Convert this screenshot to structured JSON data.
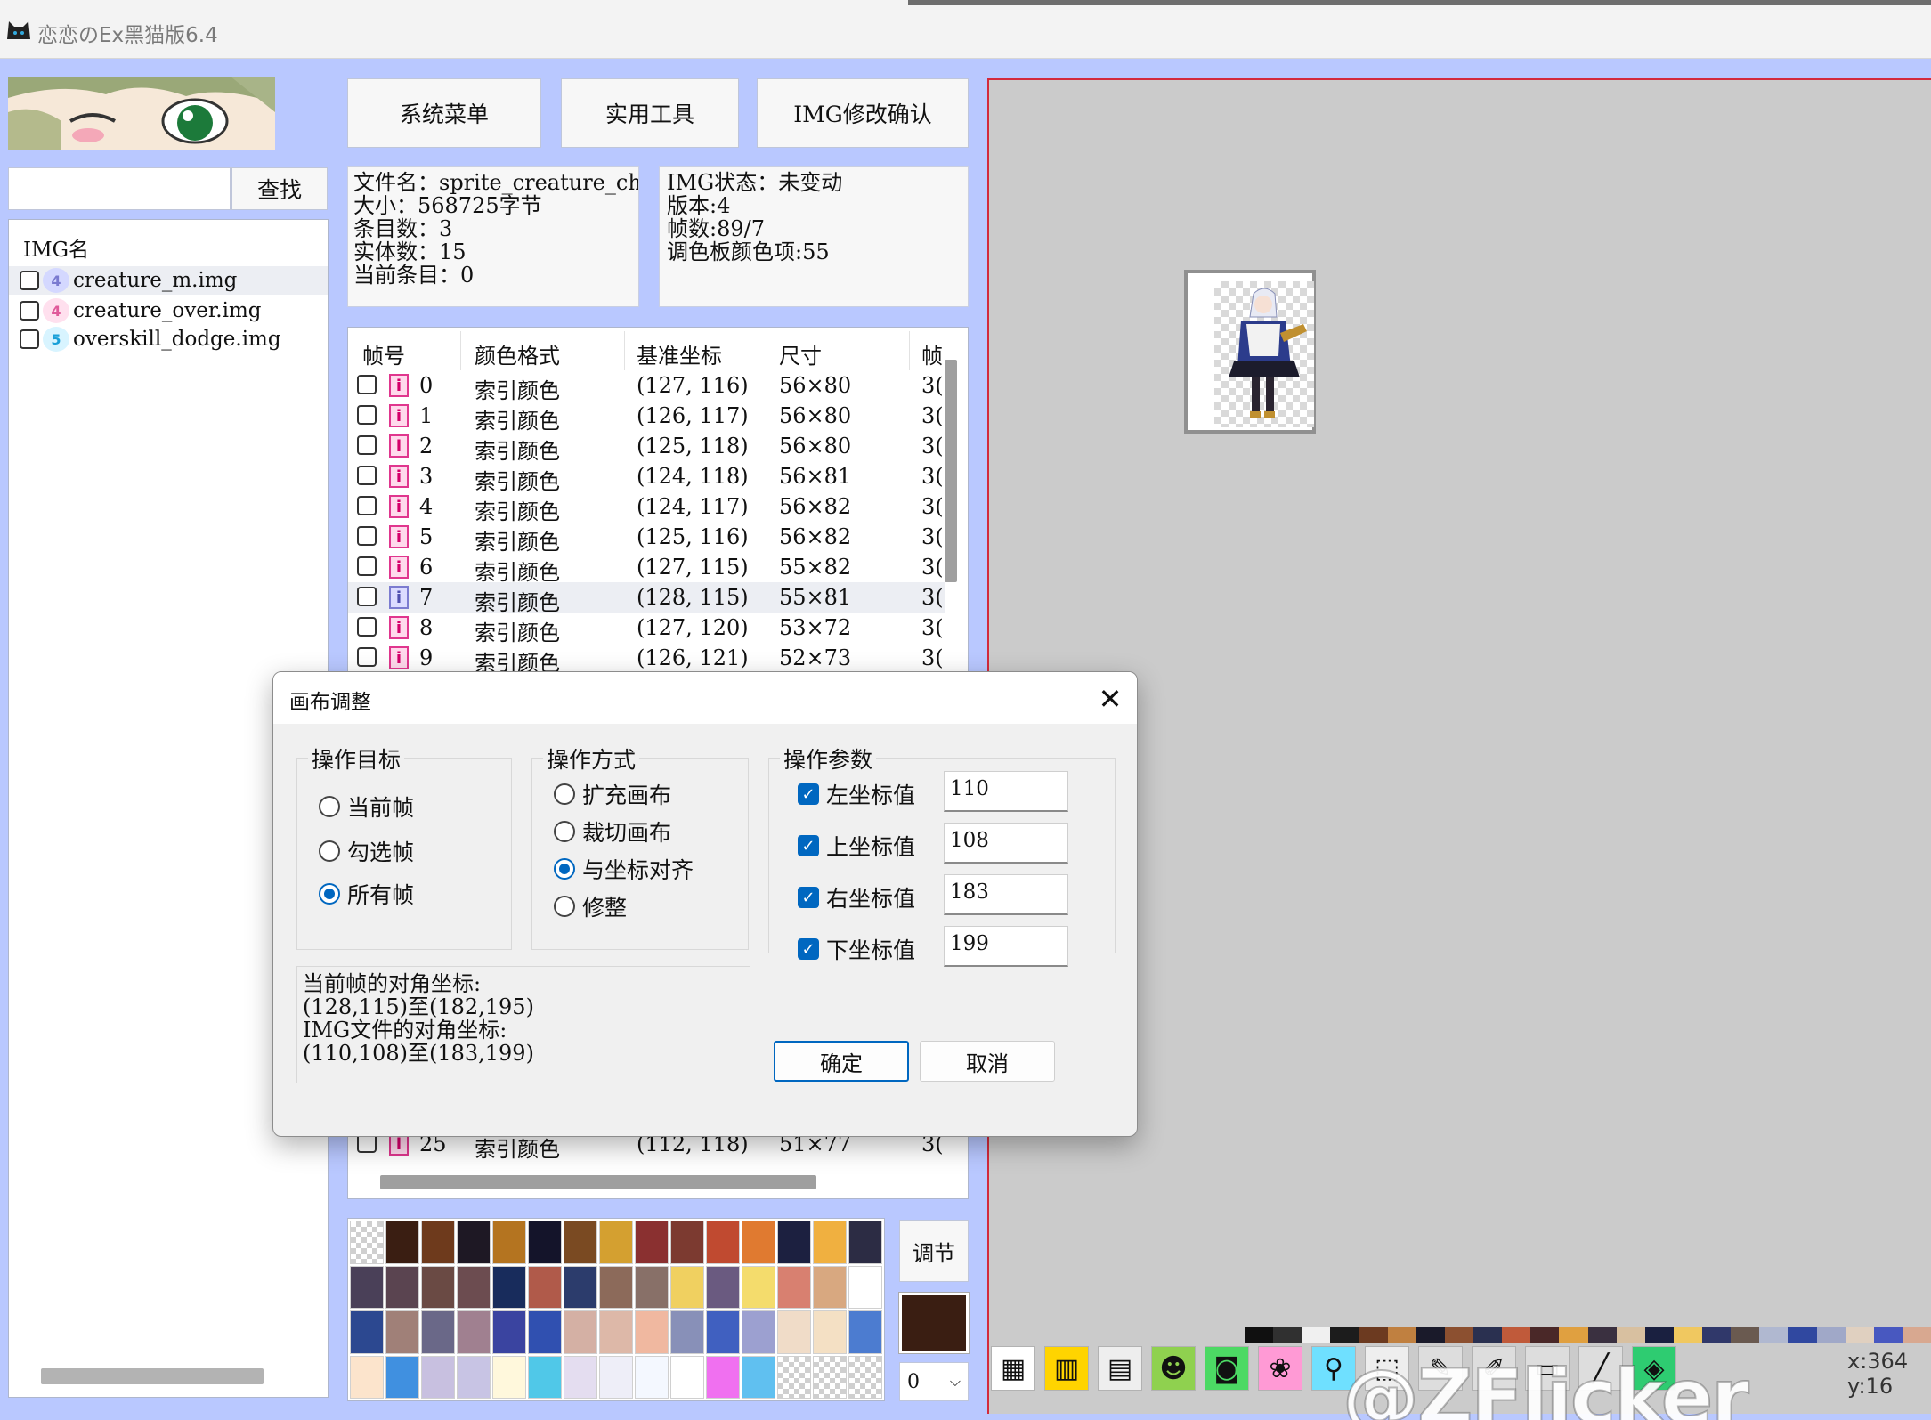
{
  "window": {
    "title": "恋恋のEx黑猫版6.4"
  },
  "toolbar_top": {
    "system_menu": "系统菜单",
    "tools": "实用工具",
    "img_confirm": "IMG修改确认"
  },
  "search": {
    "value": "",
    "placeholder": "",
    "button": "查找"
  },
  "img_list": {
    "header": "IMG名",
    "items": [
      {
        "badge": "4",
        "name": "creature_m.img",
        "selected": true
      },
      {
        "badge": "4",
        "name": "creature_over.img",
        "selected": false
      },
      {
        "badge": "5",
        "name": "overskill_dodge.img",
        "selected": false
      }
    ]
  },
  "file_info": {
    "filename": "文件名：sprite_creature_ch",
    "size": "大小：568725字节",
    "entries": "条目数：3",
    "entities": "实体数：15",
    "current": "当前条目：0"
  },
  "img_info": {
    "status": "IMG状态：未变动",
    "version": "版本:4",
    "frames": "帧数:89/7",
    "palette_count": "调色板颜色项:55"
  },
  "frame_table": {
    "headers": [
      "帧号",
      "颜色格式",
      "基准坐标",
      "尺寸",
      "帧"
    ],
    "rows": [
      {
        "id": "0",
        "format": "索引颜色",
        "coord": "(127, 116)",
        "size": "56×80",
        "extra": "3("
      },
      {
        "id": "1",
        "format": "索引颜色",
        "coord": "(126, 117)",
        "size": "56×80",
        "extra": "3("
      },
      {
        "id": "2",
        "format": "索引颜色",
        "coord": "(125, 118)",
        "size": "56×80",
        "extra": "3("
      },
      {
        "id": "3",
        "format": "索引颜色",
        "coord": "(124, 118)",
        "size": "56×81",
        "extra": "3("
      },
      {
        "id": "4",
        "format": "索引颜色",
        "coord": "(124, 117)",
        "size": "56×82",
        "extra": "3("
      },
      {
        "id": "5",
        "format": "索引颜色",
        "coord": "(125, 116)",
        "size": "56×82",
        "extra": "3("
      },
      {
        "id": "6",
        "format": "索引颜色",
        "coord": "(127, 115)",
        "size": "55×82",
        "extra": "3("
      },
      {
        "id": "7",
        "format": "索引颜色",
        "coord": "(128, 115)",
        "size": "55×81",
        "extra": "3("
      },
      {
        "id": "8",
        "format": "索引颜色",
        "coord": "(127, 120)",
        "size": "53×72",
        "extra": "3("
      },
      {
        "id": "9",
        "format": "索引颜色",
        "coord": "(126, 121)",
        "size": "52×73",
        "extra": "3("
      }
    ],
    "bottom_row": {
      "id": "25",
      "format": "索引颜色",
      "coord": "(112, 118)",
      "size": "51×77",
      "extra": "3("
    }
  },
  "palette": {
    "colors": [
      "checker",
      "#3a1e12",
      "#6e3a1c",
      "#1e1824",
      "#b47420",
      "#14142a",
      "#7a4a22",
      "#d4a030",
      "#8a3030",
      "#7c3a30",
      "#c04a30",
      "#e07a30",
      "#1c2040",
      "#f0b040",
      "#2c2c44",
      "#4a4058",
      "#5a4450",
      "#6a4a44",
      "#6c4c50",
      "#182c5c",
      "#b05a4a",
      "#2c3c6c",
      "#8c6a5a",
      "#887068",
      "#f0d060",
      "#6a5a80",
      "#f4dc6c",
      "#d88070",
      "#d8a880",
      "#ffffff",
      "#2c4890",
      "#a08078",
      "#6a6888",
      "#a08090",
      "#3a44a0",
      "#3050b0",
      "#d4b0a4",
      "#ddb8a8",
      "#f0b8a0",
      "#8890b8",
      "#4060c0",
      "#9ca0d0",
      "#f0dcc8",
      "#f4e0c4",
      "#4c7cd0",
      "#fce4cc",
      "#4090e0",
      "#c8c0e0",
      "#c8c4e4",
      "#fff8dc",
      "#50c8e8",
      "#e4ddf0",
      "#eeeef8",
      "#f4f8ff",
      "#ffffff",
      "#f070f0",
      "#60c0f0",
      "checker",
      "checker",
      "checker"
    ],
    "adjust_label": "调节",
    "current_color": "#3a1e12",
    "index_value": "0"
  },
  "mini_palette": [
    "#101010",
    "#303030",
    "#f0f0f0",
    "#1c1c1c",
    "#6c3a20",
    "#c08040",
    "#1a1a2a",
    "#8c5030",
    "#2a3050",
    "#c05a3a",
    "#4a2828",
    "#e0a040",
    "#3a3040",
    "#d8c0a0",
    "#1a2040",
    "#f0c860",
    "#30386a",
    "#6a5a50",
    "#b0b8d0",
    "#3048a0",
    "#a0a8c8",
    "#e0d0c0",
    "#4858c0",
    "#d8a890"
  ],
  "bottom_tools": [
    "table-icon",
    "palette-icon",
    "film-icon",
    "cat-icon",
    "camera-icon",
    "paw-icon",
    "magnifier-icon",
    "select-icon",
    "pencil-icon",
    "brush-icon",
    "rect-icon",
    "line-icon",
    "fill-icon"
  ],
  "coord_readout": "x:364 y:16",
  "watermark": "@ZFlicker",
  "dialog": {
    "title": "画布调整",
    "target_group": "操作目标",
    "target_options": [
      {
        "label": "当前帧",
        "checked": false
      },
      {
        "label": "勾选帧",
        "checked": false
      },
      {
        "label": "所有帧",
        "checked": true
      }
    ],
    "mode_group": "操作方式",
    "mode_options": [
      {
        "label": "扩充画布",
        "checked": false
      },
      {
        "label": "裁切画布",
        "checked": false
      },
      {
        "label": "与坐标对齐",
        "checked": true
      },
      {
        "label": "修整",
        "checked": false
      }
    ],
    "params_group": "操作参数",
    "params": [
      {
        "label": "左坐标值",
        "checked": true,
        "value": "110"
      },
      {
        "label": "上坐标值",
        "checked": true,
        "value": "108"
      },
      {
        "label": "右坐标值",
        "checked": true,
        "value": "183"
      },
      {
        "label": "下坐标值",
        "checked": true,
        "value": "199"
      }
    ],
    "coord_lines": [
      "当前帧的对角坐标:",
      "(128,115)至(182,195)",
      "IMG文件的对角坐标:",
      "(110,108)至(183,199)"
    ],
    "ok": "确定",
    "cancel": "取消"
  }
}
